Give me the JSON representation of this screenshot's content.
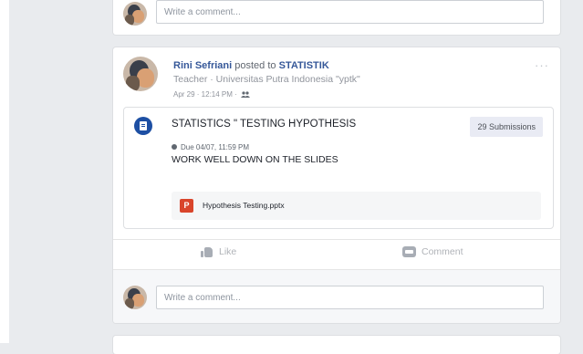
{
  "previous_post": {
    "comment_placeholder": "Write a comment..."
  },
  "post": {
    "author": "Rini Sefriani",
    "posted_to_text": "posted to",
    "group": "STATISTIK",
    "author_role": "Teacher · Universitas Putra Indonesia \"yptk\"",
    "timestamp": "Apr 29 · 12:14 PM ·",
    "privacy_icon": "group-icon",
    "menu_icon": "···",
    "assignment": {
      "title": "STATISTICS \" TESTING HYPOTHESIS",
      "submissions": "29 Submissions",
      "due": "Due 04/07, 11:59 PM",
      "instructions": "WORK WELL DOWN ON THE SLIDES",
      "attachment": {
        "icon_letter": "P",
        "file_name": "Hypothesis Testing.pptx"
      }
    },
    "actions": {
      "like": "Like",
      "comment": "Comment"
    },
    "comment_placeholder": "Write a comment..."
  },
  "colors": {
    "background": "#e9ebee",
    "link": "#365899",
    "assignment_icon": "#1d4fa3",
    "ppt_icon": "#d9452b"
  }
}
